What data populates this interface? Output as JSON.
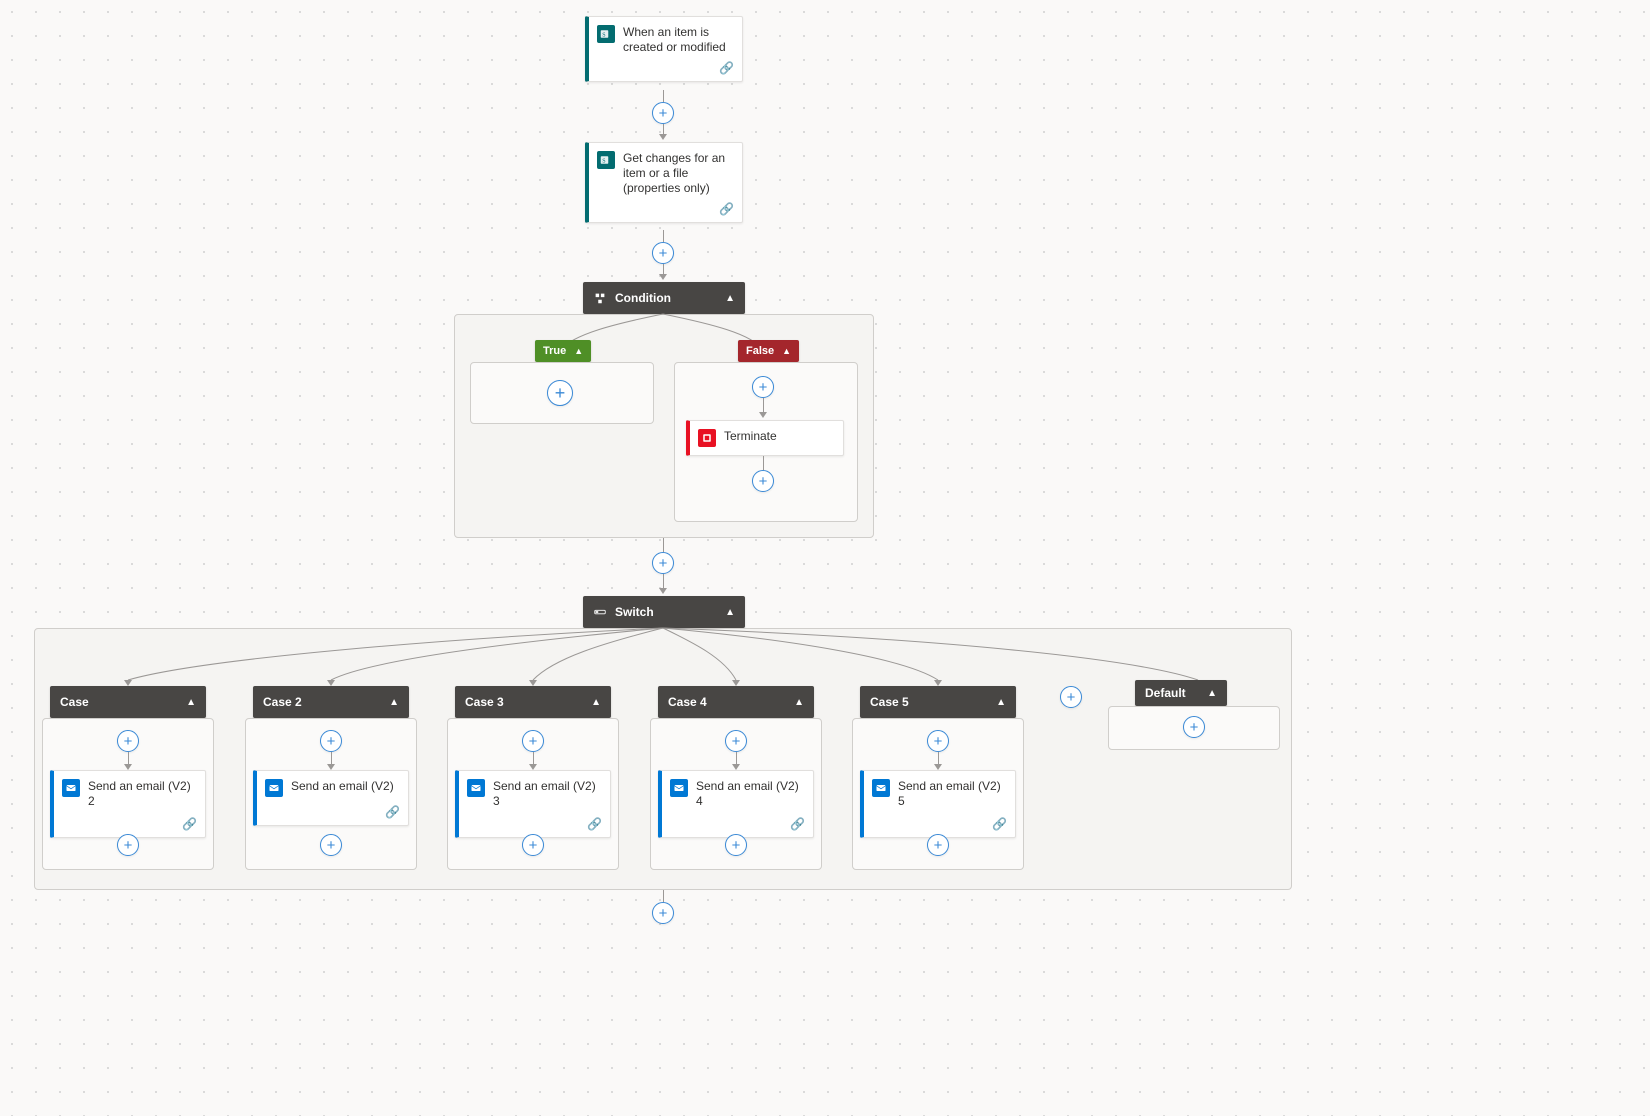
{
  "colors": {
    "sharepoint_accent": "#036c70",
    "terminate_accent": "#e81123",
    "outlook_accent": "#0078d4",
    "header_dark": "#484644",
    "true_badge": "#4f8f26",
    "false_badge": "#a4262c"
  },
  "trigger": {
    "title": "When an item is created or modified"
  },
  "get_changes": {
    "title": "Get changes for an item or a file (properties only)"
  },
  "condition": {
    "title": "Condition",
    "true_label": "True",
    "false_label": "False",
    "false_action": {
      "title": "Terminate"
    }
  },
  "switch": {
    "title": "Switch",
    "default_label": "Default",
    "cases": [
      {
        "label": "Case",
        "action": "Send an email (V2) 2"
      },
      {
        "label": "Case 2",
        "action": "Send an email (V2)"
      },
      {
        "label": "Case 3",
        "action": "Send an email (V2) 3"
      },
      {
        "label": "Case 4",
        "action": "Send an email (V2) 4"
      },
      {
        "label": "Case 5",
        "action": "Send an email (V2) 5"
      }
    ]
  }
}
